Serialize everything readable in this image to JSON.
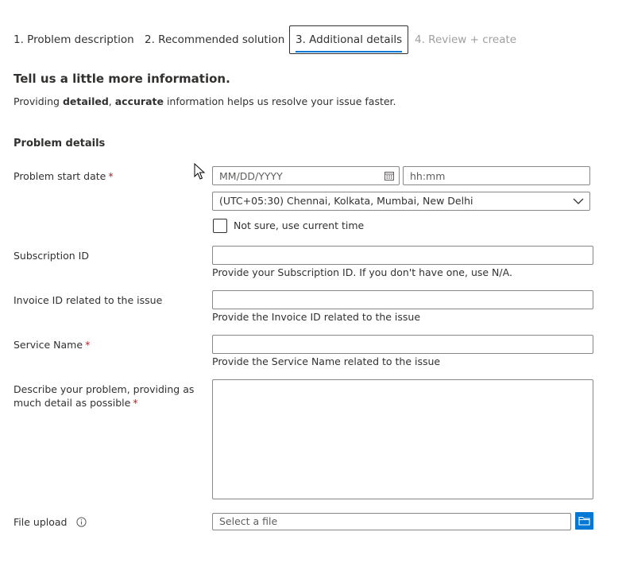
{
  "tabs": [
    {
      "label": "1. Problem description"
    },
    {
      "label": "2. Recommended solution"
    },
    {
      "label": "3. Additional details"
    },
    {
      "label": "4. Review + create"
    }
  ],
  "heading": "Tell us a little more information.",
  "intro": {
    "prefix": "Providing ",
    "bold1": "detailed",
    "sep": ", ",
    "bold2": "accurate",
    "suffix": " information helps us resolve your issue faster."
  },
  "section_title": "Problem details",
  "required_mark": "*",
  "fields": {
    "start_date": {
      "label": "Problem start date",
      "date_placeholder": "MM/DD/YYYY",
      "time_placeholder": "hh:mm",
      "timezone": "(UTC+05:30) Chennai, Kolkata, Mumbai, New Delhi",
      "not_sure_label": "Not sure, use current time"
    },
    "subscription": {
      "label": "Subscription ID",
      "value": "",
      "hint": "Provide your Subscription ID. If you don't have one, use N/A."
    },
    "invoice": {
      "label": "Invoice ID related to the issue",
      "value": "",
      "hint": "Provide the Invoice ID related to the issue"
    },
    "service": {
      "label": "Service Name",
      "value": "",
      "hint": "Provide the Service Name related to the issue"
    },
    "description": {
      "label_line1": "Describe your problem, providing as",
      "label_line2": "much detail as possible"
    },
    "file_upload": {
      "label": "File upload",
      "placeholder": "Select a file"
    }
  },
  "colors": {
    "accent": "#0078d4",
    "required": "#a4262c",
    "border": "#8a8886"
  },
  "icons": {
    "calendar": "calendar-icon",
    "chevron": "chevron-down-icon",
    "info": "info-icon",
    "folder": "folder-icon"
  }
}
